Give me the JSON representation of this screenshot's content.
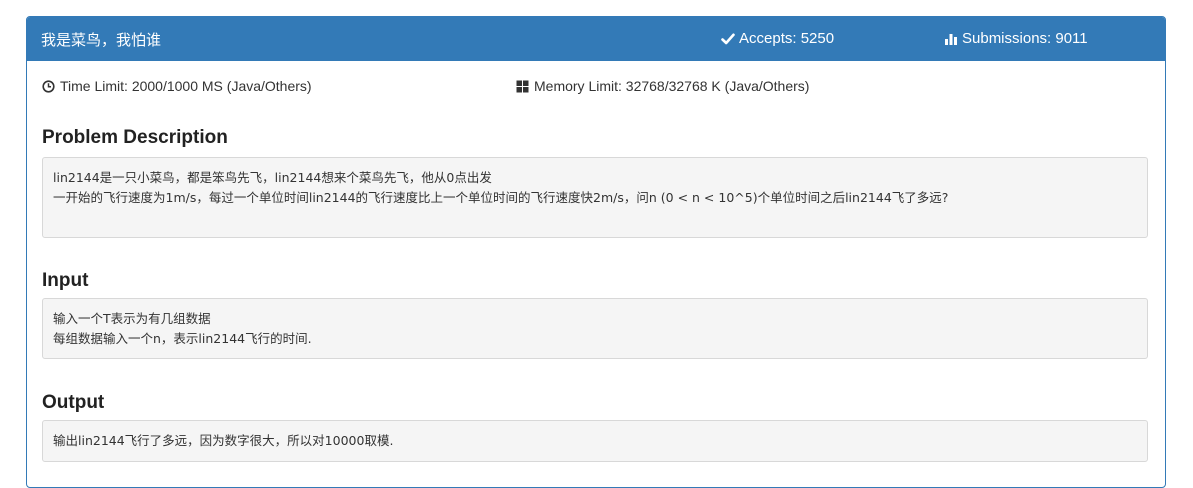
{
  "header": {
    "title": "我是菜鸟，我怕谁",
    "accepts": "Accepts: 5250",
    "submissions": "Submissions: 9011"
  },
  "limits": {
    "time": "Time Limit: 2000/1000 MS (Java/Others)",
    "memory": "Memory Limit: 32768/32768 K (Java/Others)"
  },
  "problem_description": {
    "title": "Problem Description",
    "lines": [
      "lin2144是一只小菜鸟，都是笨鸟先飞，lin2144想来个菜鸟先飞，他从0点出发",
      "一开始的飞行速度为1m/s，每过一个单位时间lin2144的飞行速度比上一个单位时间的飞行速度快2m/s，问n (0 < n < 10^5)个单位时间之后lin2144飞了多远?"
    ]
  },
  "input": {
    "title": "Input",
    "lines": [
      "输入一个T表示为有几组数据",
      "每组数据输入一个n，表示lin2144飞行的时间."
    ]
  },
  "output": {
    "title": "Output",
    "lines": [
      "输出lin2144飞行了多远，因为数字很大，所以对10000取模."
    ]
  },
  "colors": {
    "header_bg": "#337ab7",
    "box_bg": "#f5f5f5"
  },
  "icons": {
    "accepts": "check-icon",
    "submissions": "bar-chart-icon",
    "time": "clock-icon",
    "memory": "grid-icon"
  }
}
